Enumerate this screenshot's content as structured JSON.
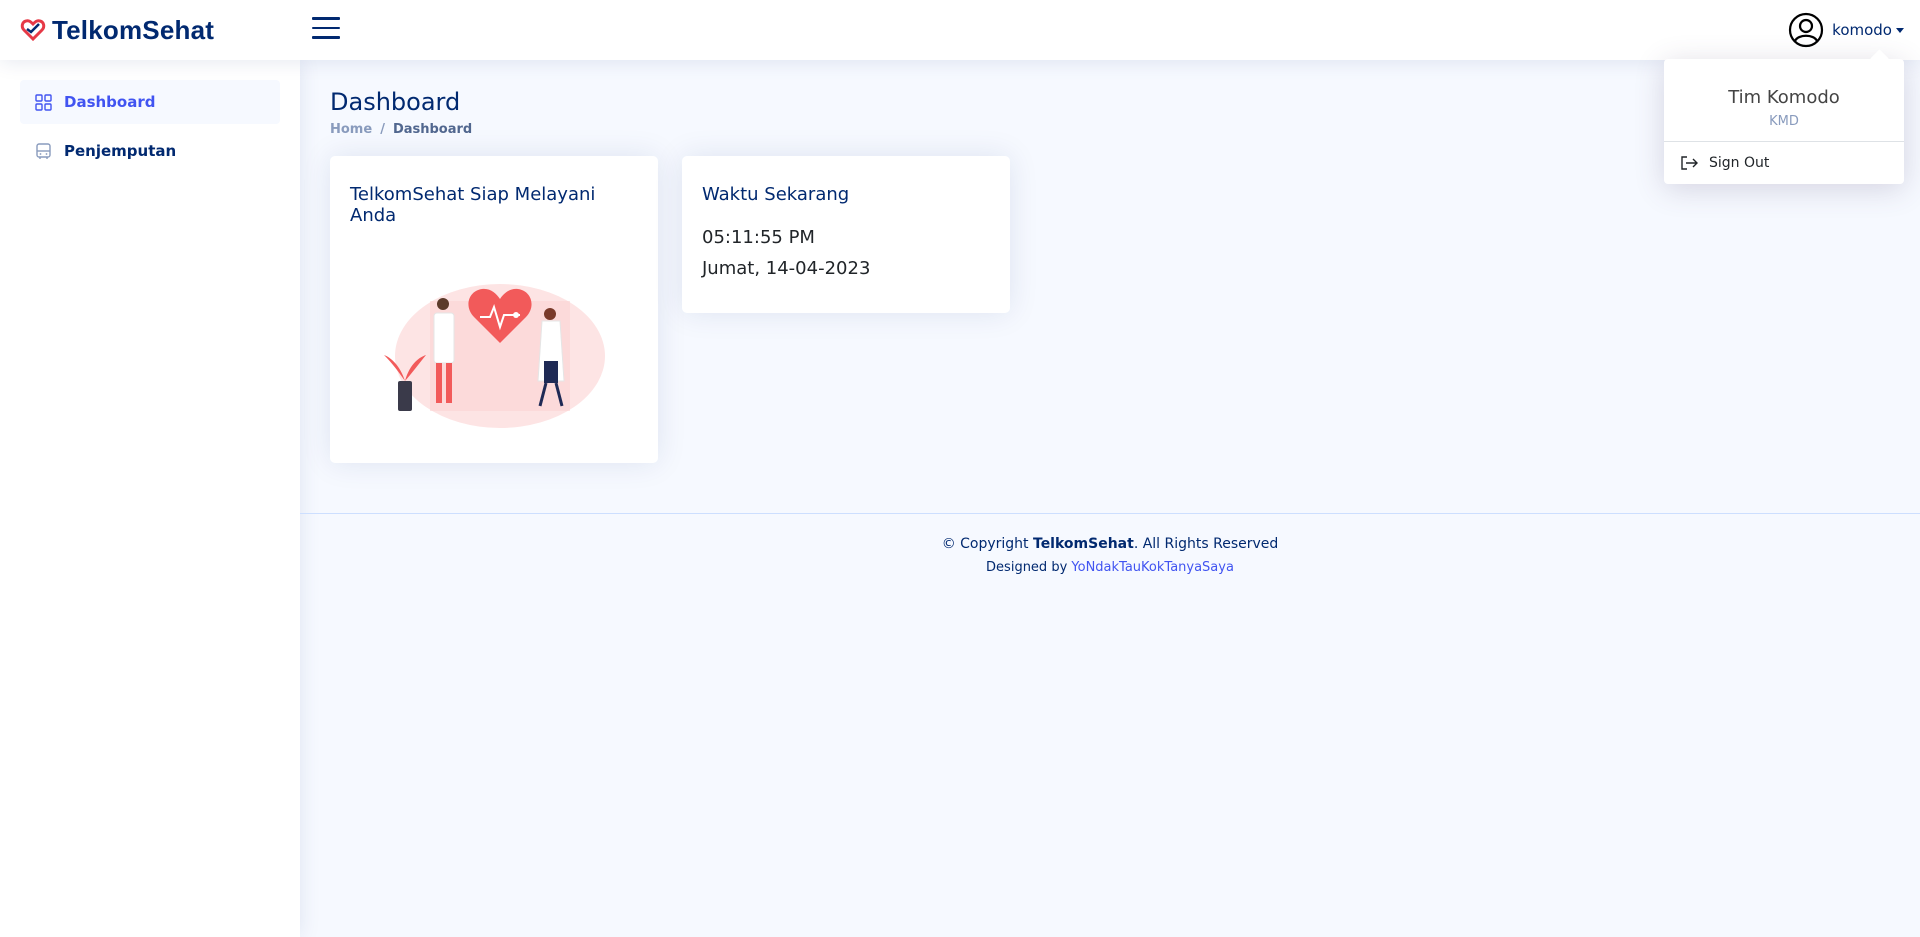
{
  "header": {
    "logo_text": "TelkomSehat",
    "username": "komodo"
  },
  "dropdown": {
    "full_name": "Tim Komodo",
    "subtitle": "KMD",
    "sign_out": "Sign Out"
  },
  "sidebar": {
    "items": [
      {
        "label": "Dashboard",
        "active": true,
        "icon": "grid-icon"
      },
      {
        "label": "Penjemputan",
        "active": false,
        "icon": "bus-icon"
      }
    ]
  },
  "page": {
    "title": "Dashboard",
    "breadcrumb": {
      "home": "Home",
      "separator": "/",
      "current": "Dashboard"
    }
  },
  "cards": {
    "welcome": {
      "title": "TelkomSehat Siap Melayani Anda"
    },
    "clock": {
      "title": "Waktu Sekarang",
      "time": "05:11:55 PM",
      "date": "Jumat, 14-04-2023"
    }
  },
  "footer": {
    "copyright_prefix": "© Copyright",
    "brand": "TelkomSehat",
    "copyright_suffix": ". All Rights Reserved",
    "designed_by": "Designed by",
    "designer": "YoNdakTauKokTanyaSaya"
  },
  "colors": {
    "primary": "#012970",
    "accent": "#4154f1",
    "background": "#f6f9ff",
    "heart": "#f25a5a"
  }
}
